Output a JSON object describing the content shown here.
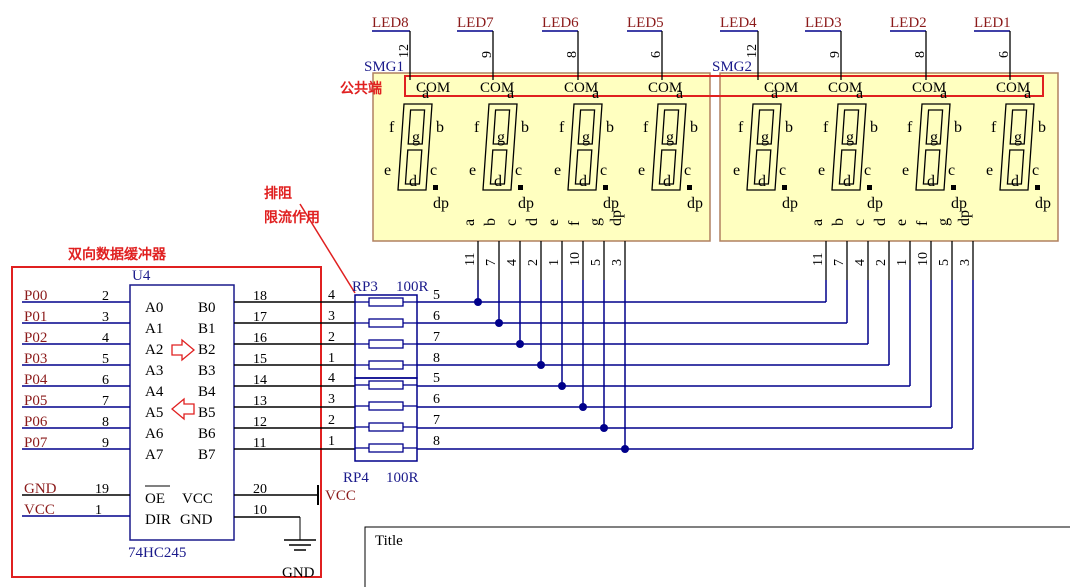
{
  "title_block": {
    "label": "Title"
  },
  "annotations": {
    "common": "公共端",
    "resistor_array_1": "排阻",
    "resistor_array_2": "限流作用",
    "buffer": "双向数据缓冲器"
  },
  "colors": {
    "net": "#00008b",
    "label_red": "#8b1a1a",
    "label_blue": "#1a1a8b",
    "display_fill": "#ffffc0",
    "display_border": "#b08060",
    "annotation": "#e02020"
  },
  "display_groups": [
    {
      "name": "SMG1",
      "digits": [
        {
          "led": "LED8",
          "pin": "12",
          "com": "COM"
        },
        {
          "led": "LED7",
          "pin": "9",
          "com": "COM"
        },
        {
          "led": "LED6",
          "pin": "8",
          "com": "COM"
        },
        {
          "led": "LED5",
          "pin": "6",
          "com": "COM"
        }
      ]
    },
    {
      "name": "SMG2",
      "digits": [
        {
          "led": "LED4",
          "pin": "12",
          "com": "COM"
        },
        {
          "led": "LED3",
          "pin": "9",
          "com": "COM"
        },
        {
          "led": "LED2",
          "pin": "8",
          "com": "COM"
        },
        {
          "led": "LED1",
          "pin": "6",
          "com": "COM"
        }
      ]
    }
  ],
  "segment_letters": [
    "a",
    "b",
    "c",
    "d",
    "e",
    "f",
    "g",
    "dp"
  ],
  "segment_pins": [
    "11",
    "7",
    "4",
    "2",
    "1",
    "10",
    "5",
    "3"
  ],
  "chip": {
    "ref": "U4",
    "part": "74HC245",
    "inputs": [
      {
        "net": "P00",
        "pin": "2",
        "name": "A0"
      },
      {
        "net": "P01",
        "pin": "3",
        "name": "A1"
      },
      {
        "net": "P02",
        "pin": "4",
        "name": "A2"
      },
      {
        "net": "P03",
        "pin": "5",
        "name": "A3"
      },
      {
        "net": "P04",
        "pin": "6",
        "name": "A4"
      },
      {
        "net": "P05",
        "pin": "7",
        "name": "A5"
      },
      {
        "net": "P06",
        "pin": "8",
        "name": "A6"
      },
      {
        "net": "P07",
        "pin": "9",
        "name": "A7"
      }
    ],
    "outputs": [
      {
        "name": "B0",
        "pin": "18"
      },
      {
        "name": "B1",
        "pin": "17"
      },
      {
        "name": "B2",
        "pin": "16"
      },
      {
        "name": "B3",
        "pin": "15"
      },
      {
        "name": "B4",
        "pin": "14"
      },
      {
        "name": "B5",
        "pin": "13"
      },
      {
        "name": "B6",
        "pin": "12"
      },
      {
        "name": "B7",
        "pin": "11"
      }
    ],
    "ctrl": [
      {
        "net": "GND",
        "pin": "19",
        "name": "OE"
      },
      {
        "net": "VCC",
        "pin": "1",
        "name": "DIR"
      }
    ],
    "power": [
      {
        "name": "VCC",
        "pin": "20",
        "net": "VCC"
      },
      {
        "name": "GND",
        "pin": "10",
        "net": "GND"
      }
    ]
  },
  "resistor_arrays": [
    {
      "ref": "RP3",
      "value": "100R",
      "left_pins": [
        "4",
        "3",
        "2",
        "1"
      ],
      "right_pins": [
        "5",
        "6",
        "7",
        "8"
      ]
    },
    {
      "ref": "RP4",
      "value": "100R",
      "left_pins": [
        "4",
        "3",
        "2",
        "1"
      ],
      "right_pins": [
        "5",
        "6",
        "7",
        "8"
      ]
    }
  ]
}
